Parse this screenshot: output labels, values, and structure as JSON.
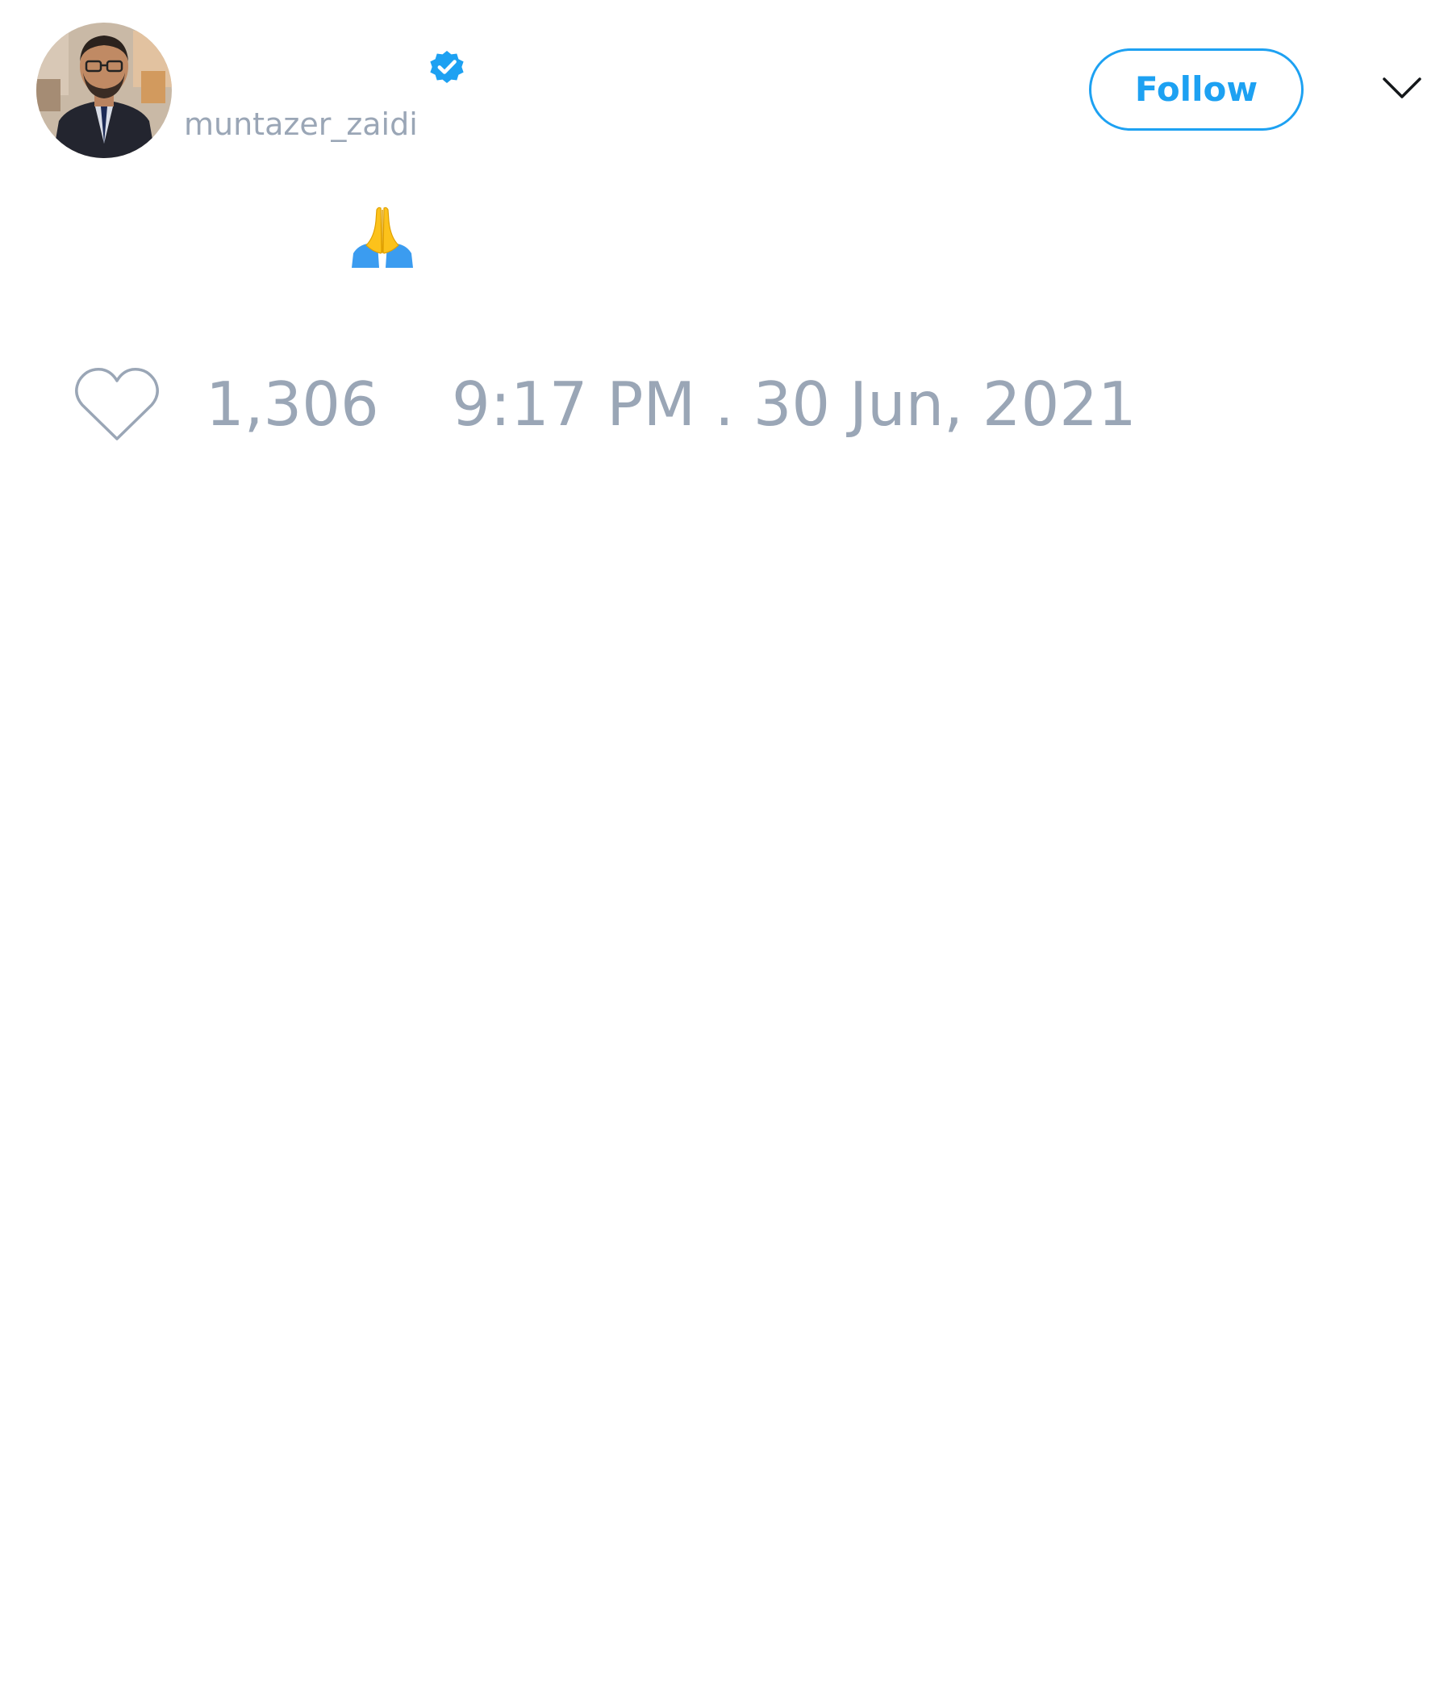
{
  "tweet": {
    "author": {
      "display_name": "",
      "handle": "muntazer_zaidi",
      "verified": true,
      "avatar_icon": "user-avatar-photo"
    },
    "follow_label": "Follow",
    "menu_icon": "chevron-down-icon",
    "text": "",
    "emoji": "folded-hands-emoji",
    "like_icon": "heart-outline-icon",
    "likes": "1,306",
    "timestamp": "9:17 PM . 30 Jun, 2021"
  },
  "colors": {
    "accent": "#1da1f2",
    "muted_text": "#9aa6b6",
    "background": "#ffffff"
  }
}
